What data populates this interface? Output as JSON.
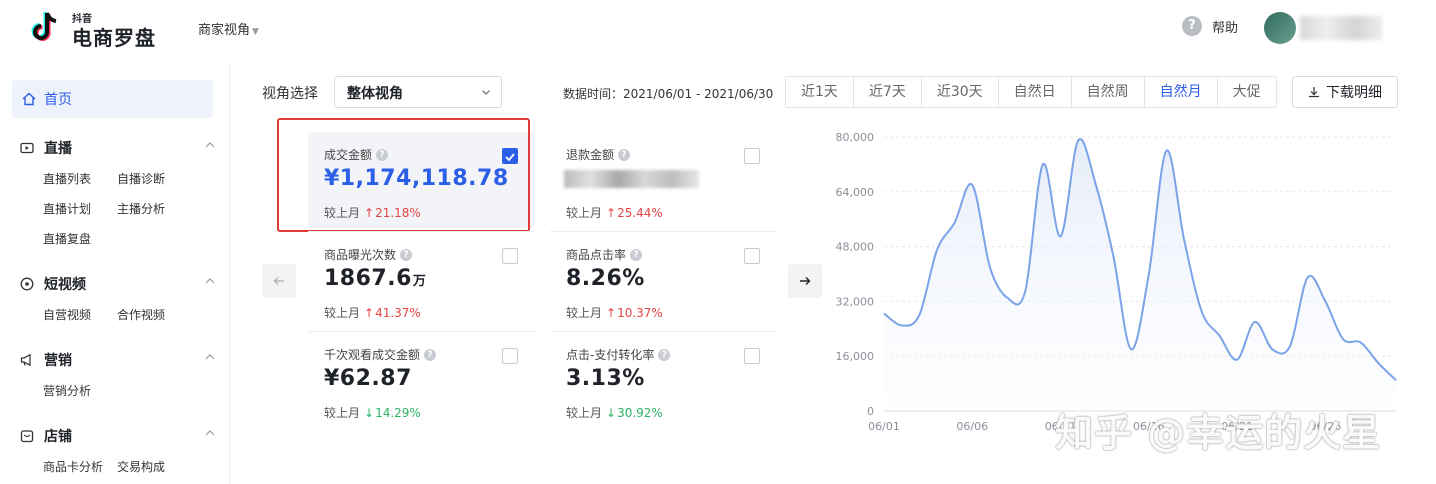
{
  "header": {
    "logo_small": "抖音",
    "logo_text": "电商罗盘",
    "role_label": "商家视角",
    "help_label": "帮助"
  },
  "sidebar": {
    "home": "首页",
    "groups": [
      {
        "label": "直播",
        "items": [
          "直播列表",
          "自播诊断",
          "直播计划",
          "主播分析",
          "直播复盘"
        ]
      },
      {
        "label": "短视频",
        "items": [
          "自营视频",
          "合作视频"
        ]
      },
      {
        "label": "营销",
        "items": [
          "营销分析"
        ]
      },
      {
        "label": "店铺",
        "items": [
          "商品卡分析",
          "交易构成"
        ]
      }
    ]
  },
  "filters": {
    "view_label": "视角选择",
    "view_value": "整体视角",
    "date_range": "数据时间：2021/06/01 - 2021/06/30",
    "range_tabs": [
      "近1天",
      "近7天",
      "近30天",
      "自然日",
      "自然周",
      "自然月",
      "大促"
    ],
    "active_tab": "自然月",
    "download_label": "下载明细"
  },
  "metrics": [
    {
      "label": "成交金额",
      "value": "¥1,174,118.78",
      "compare_label": "较上月",
      "change": "21.18%",
      "trend": "up",
      "checked": true
    },
    {
      "label": "退款金额",
      "value": "",
      "compare_label": "较上月",
      "change": "25.44%",
      "trend": "up",
      "checked": false
    },
    {
      "label": "商品曝光次数",
      "value": "1867.6",
      "unit": "万",
      "compare_label": "较上月",
      "change": "41.37%",
      "trend": "up",
      "checked": false
    },
    {
      "label": "商品点击率",
      "value": "8.26%",
      "compare_label": "较上月",
      "change": "10.37%",
      "trend": "up",
      "checked": false
    },
    {
      "label": "千次观看成交金额",
      "value": "¥62.87",
      "compare_label": "较上月",
      "change": "14.29%",
      "trend": "down",
      "checked": false
    },
    {
      "label": "点击-支付转化率",
      "value": "3.13%",
      "compare_label": "较上月",
      "change": "30.92%",
      "trend": "down",
      "checked": false
    }
  ],
  "watermark": "知乎 @幸运的火星",
  "colors": {
    "accent": "#2d5ee8",
    "up": "#e64545",
    "down": "#2cb364",
    "line": "#7aa3e8",
    "highlight": "#e23a36"
  },
  "chart_data": {
    "type": "area",
    "title": "",
    "xlabel": "",
    "ylabel": "",
    "ylim": [
      0,
      80000
    ],
    "y_ticks": [
      "0",
      "16,000",
      "32,000",
      "48,000",
      "64,000",
      "80,000"
    ],
    "x_tick_labels": [
      "06/01",
      "06/06",
      "06/11",
      "06/16",
      "06/21",
      "06/26"
    ],
    "grid": true,
    "x": [
      "06/01",
      "06/02",
      "06/03",
      "06/04",
      "06/05",
      "06/06",
      "06/07",
      "06/08",
      "06/09",
      "06/10",
      "06/11",
      "06/12",
      "06/13",
      "06/14",
      "06/15",
      "06/16",
      "06/17",
      "06/18",
      "06/19",
      "06/20",
      "06/21",
      "06/22",
      "06/23",
      "06/24",
      "06/25",
      "06/26",
      "06/27",
      "06/28",
      "06/29",
      "06/30"
    ],
    "series": [
      {
        "values": [
          28500,
          25000,
          28000,
          47000,
          55000,
          66000,
          42000,
          33000,
          35000,
          72000,
          51000,
          79000,
          66000,
          45000,
          18000,
          40000,
          76000,
          50000,
          29000,
          22000,
          15000,
          26000,
          18000,
          19000,
          39000,
          32000,
          21000,
          20000,
          14000,
          9000
        ]
      }
    ]
  }
}
